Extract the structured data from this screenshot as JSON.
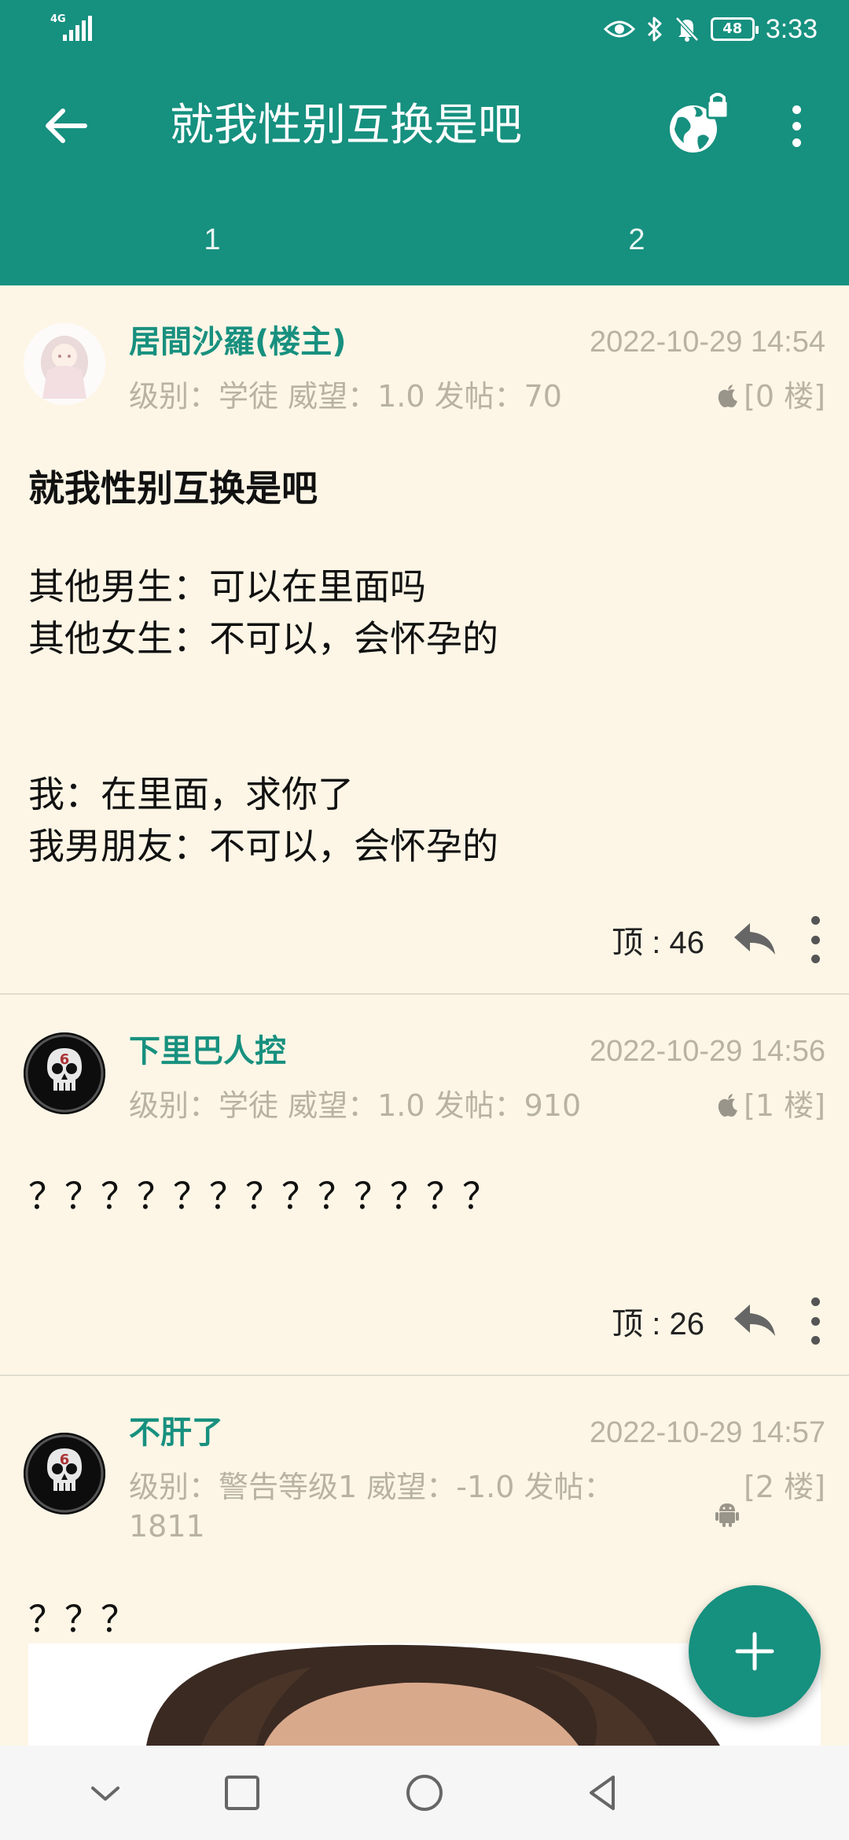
{
  "status_bar": {
    "network": "4G",
    "battery": "48",
    "time": "3:33"
  },
  "header": {
    "title": "就我性别互换是吧",
    "tabs": [
      {
        "label": "1"
      },
      {
        "label": "2"
      }
    ]
  },
  "posts": [
    {
      "user": "居間沙羅(楼主)",
      "time": "2022-10-29 14:54",
      "meta": "级别：学徒   威望：1.0   发帖：70",
      "floor": "[0 楼]",
      "device_icon": "apple-icon",
      "title": "就我性别互换是吧",
      "body": "其他男生：可以在里面吗\n其他女生：不可以，会怀孕的\n\n\n我：在里面，求你了\n我男朋友：不可以，会怀孕的",
      "likes": "顶 : 46"
    },
    {
      "user": "下里巴人控",
      "time": "2022-10-29 14:56",
      "meta": "级别：学徒   威望：1.0   发帖：910",
      "floor": "[1 楼]",
      "device_icon": "apple-icon",
      "body": "？？？？？？？？？？？？？",
      "likes": "顶 : 26"
    },
    {
      "user": "不肝了",
      "time": "2022-10-29 14:57",
      "meta": "级别：警告等级1   威望：-1.0   发帖：\n1811",
      "floor": "[2 楼]",
      "device_icon": "android-icon",
      "body": "？？？"
    }
  ],
  "colors": {
    "primary": "#16907f",
    "background": "#fdf6e6",
    "meta_text": "#b8b2a3"
  }
}
